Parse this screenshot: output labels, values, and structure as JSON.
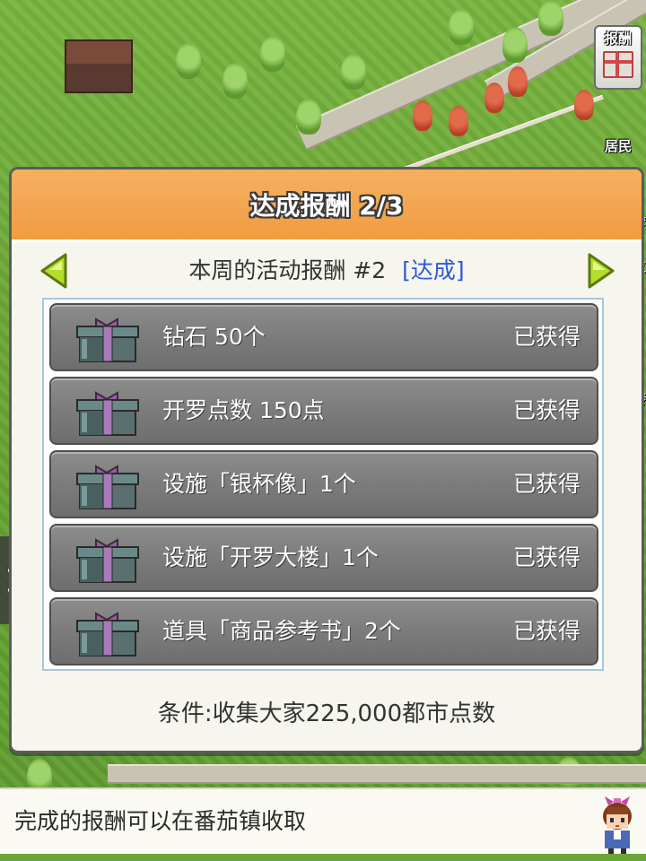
{
  "hud": {
    "reward_button_label": "报酬",
    "resident_button_label": "居民",
    "edge_fragments": [
      "会",
      "好友",
      "运转"
    ]
  },
  "dialog": {
    "title": "达成报酬 2/3",
    "subtitle": "本周的活动报酬 #2",
    "achieved_tag": "[达成]",
    "rewards": [
      {
        "name": "钻石 50个",
        "status": "已获得"
      },
      {
        "name": "开罗点数 150点",
        "status": "已获得"
      },
      {
        "name": "设施「银杯像」1个",
        "status": "已获得"
      },
      {
        "name": "设施「开罗大楼」1个",
        "status": "已获得"
      },
      {
        "name": "道具「商品参考书」2个",
        "status": "已获得"
      }
    ],
    "condition": "条件:收集大家225,000都市点数"
  },
  "message_bar": {
    "text": "完成的报酬可以在番茄镇收取"
  },
  "colors": {
    "header_orange": "#f19c40",
    "arrow_green": "#b6dc2c",
    "achieved_blue": "#2a5ad8",
    "row_gray": "#7d7d7d"
  }
}
